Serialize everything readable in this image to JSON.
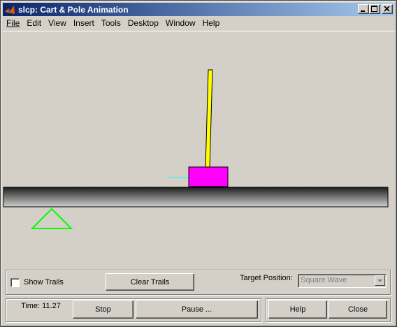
{
  "window": {
    "title": "slcp: Cart & Pole Animation"
  },
  "menu": [
    "File",
    "Edit",
    "View",
    "Insert",
    "Tools",
    "Desktop",
    "Window",
    "Help"
  ],
  "controls": {
    "show_trails_label": "Show Trails",
    "show_trails_checked": false,
    "clear_trails_label": "Clear Trails",
    "target_position_label": "Target Position:",
    "target_position_value": "Square Wave",
    "time_label": "Time: 11.27",
    "stop_label": "Stop",
    "pause_label": "Pause ...",
    "help_label": "Help",
    "close_label": "Close"
  },
  "colors": {
    "cart": "#ff00ff",
    "pole": "#ffff00",
    "target_marker": "#00ff00",
    "force_arrow": "#00ffff",
    "track_dark": "#202020",
    "track_light": "#c8c8c8"
  }
}
